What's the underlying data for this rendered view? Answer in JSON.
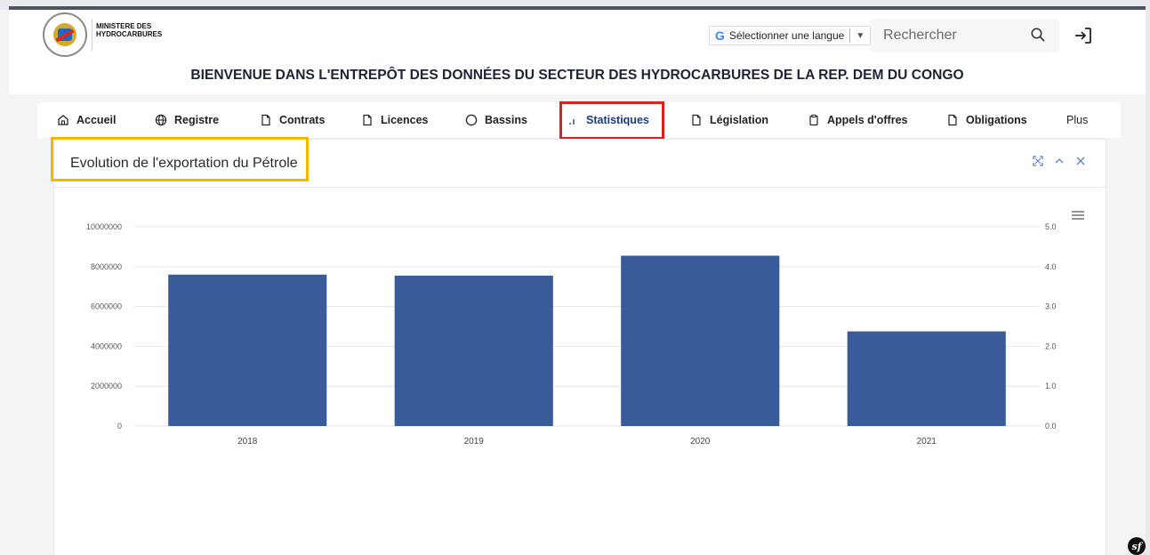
{
  "header": {
    "ministry_line1": "MINISTERE DES",
    "ministry_line2": "HYDROCARBURES",
    "language_label": "Sélectionner une langue",
    "search_placeholder": "Rechercher",
    "welcome": "BIENVENUE DANS L'ENTREPÔT DES DONNÉES DU SECTEUR DES HYDROCARBURES DE LA REP. DEM DU CONGO"
  },
  "nav": {
    "items": [
      {
        "label": "Accueil",
        "icon": "home-icon"
      },
      {
        "label": "Registre",
        "icon": "globe-icon"
      },
      {
        "label": "Contrats",
        "icon": "document-icon"
      },
      {
        "label": "Licences",
        "icon": "document-icon"
      },
      {
        "label": "Bassins",
        "icon": "circle-icon"
      },
      {
        "label": "Statistiques",
        "icon": "bar-chart-icon",
        "active": true
      },
      {
        "label": "Législation",
        "icon": "document-icon"
      },
      {
        "label": "Appels d'offres",
        "icon": "clipboard-icon"
      },
      {
        "label": "Obligations",
        "icon": "document-icon"
      },
      {
        "label": "Plus",
        "icon": ""
      }
    ]
  },
  "card": {
    "title": "Evolution de l'exportation du Pétrole"
  },
  "chart_data": {
    "type": "bar",
    "categories": [
      "2018",
      "2019",
      "2020",
      "2021"
    ],
    "values": [
      7600000,
      7550000,
      8550000,
      4750000
    ],
    "ylim": [
      0,
      10000000
    ],
    "y_ticks": [
      "0",
      "2000000",
      "4000000",
      "6000000",
      "8000000",
      "10000000"
    ],
    "y2_ticks": [
      "0.0",
      "1.0",
      "2.0",
      "3.0",
      "4.0",
      "5.0"
    ],
    "bar_color": "#3a5b9a",
    "grid": true
  },
  "colors": {
    "accent": "#1d3b7a",
    "highlight_red": "#e11d1d",
    "highlight_yellow": "#f5b800"
  }
}
